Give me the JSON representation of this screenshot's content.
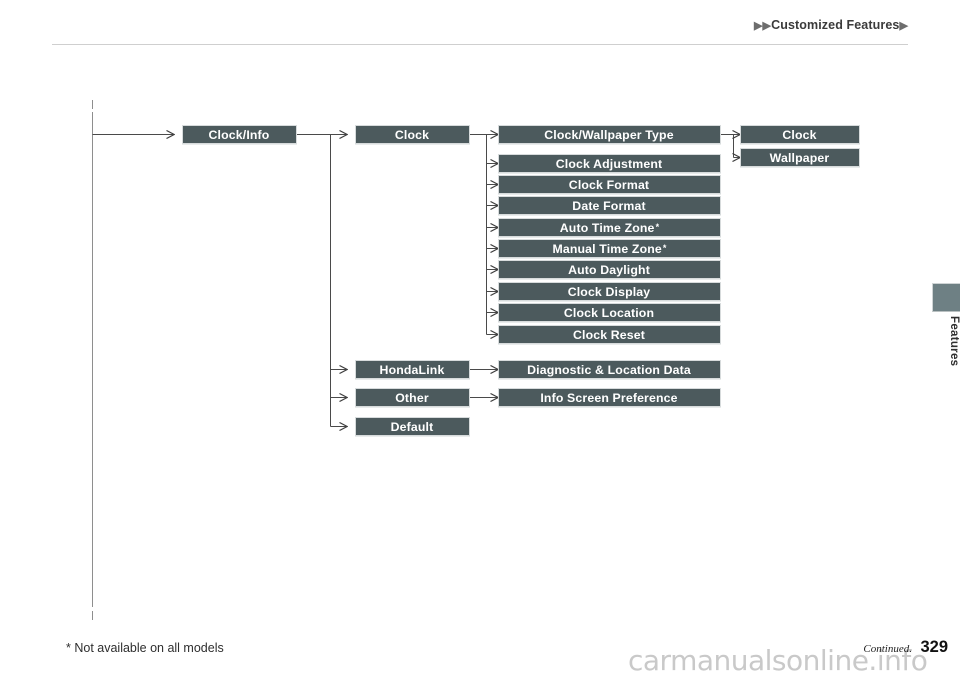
{
  "header": {
    "title": "Customized Features",
    "marker_left": "▶▶",
    "marker_right": "▶"
  },
  "side_tab": {
    "label": "Features",
    "color": "#6e8084"
  },
  "theme": {
    "box_fill": "#4c5a5d",
    "box_text": "#ffffff",
    "line": "#4a4a4a",
    "rule": "#9a9a9a"
  },
  "diagram": {
    "type": "menu-tree",
    "columns": [
      {
        "name": "level-1",
        "items": [
          {
            "label": "Clock/Info",
            "note": ""
          }
        ]
      },
      {
        "name": "level-2",
        "items": [
          {
            "label": "Clock",
            "note": ""
          },
          {
            "label": "HondaLink",
            "note": ""
          },
          {
            "label": "Other",
            "note": ""
          },
          {
            "label": "Default",
            "note": ""
          }
        ]
      },
      {
        "name": "level-3",
        "items": [
          {
            "label": "Clock/Wallpaper Type",
            "note": ""
          },
          {
            "label": "Clock Adjustment",
            "note": ""
          },
          {
            "label": "Clock Format",
            "note": ""
          },
          {
            "label": "Date Format",
            "note": ""
          },
          {
            "label": "Auto Time Zone",
            "note": "*"
          },
          {
            "label": "Manual Time Zone",
            "note": "*"
          },
          {
            "label": "Auto Daylight",
            "note": ""
          },
          {
            "label": "Clock Display",
            "note": ""
          },
          {
            "label": "Clock Location",
            "note": ""
          },
          {
            "label": "Clock Reset",
            "note": ""
          },
          {
            "label": "Diagnostic & Location Data",
            "note": ""
          },
          {
            "label": "Info Screen Preference",
            "note": ""
          }
        ]
      },
      {
        "name": "level-4",
        "items": [
          {
            "label": "Clock",
            "note": ""
          },
          {
            "label": "Wallpaper",
            "note": ""
          }
        ]
      }
    ]
  },
  "footer": {
    "footnote": "* Not available on all models",
    "continued": "Continued.",
    "page_number": "329",
    "watermark": "carmanualsonline.info"
  }
}
